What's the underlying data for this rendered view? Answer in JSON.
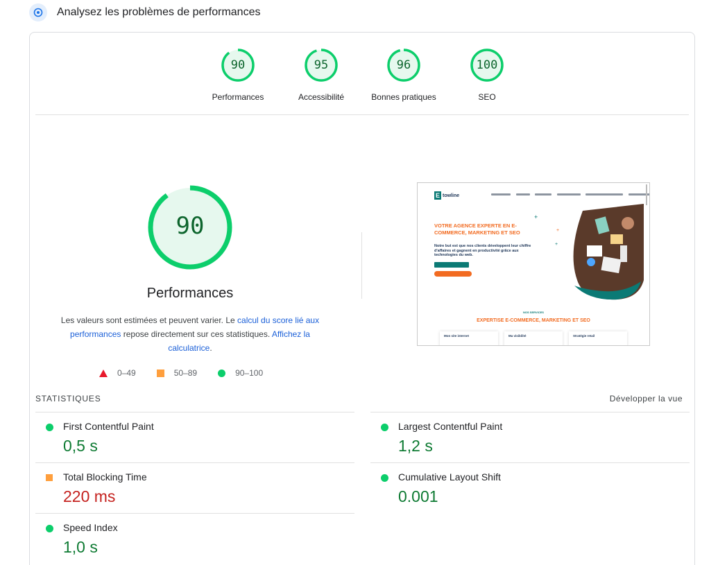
{
  "header": {
    "title": "Analysez les problèmes de performances",
    "icon": "speed-gauge-icon"
  },
  "categories": [
    {
      "label": "Performances",
      "score": "90",
      "value": 90
    },
    {
      "label": "Accessibilité",
      "score": "95",
      "value": 95
    },
    {
      "label": "Bonnes pratiques",
      "score": "96",
      "value": 96
    },
    {
      "label": "SEO",
      "score": "100",
      "value": 100
    }
  ],
  "main": {
    "score": "90",
    "value": 90,
    "label": "Performances",
    "desc_1": "Les valeurs sont estimées et peuvent varier. Le ",
    "desc_link_1": "calcul du score lié aux performances",
    "desc_2": " repose directement sur ces statistiques. ",
    "desc_link_2": "Affichez la calculatrice",
    "desc_3": "."
  },
  "legend": [
    {
      "range": "0–49",
      "shape": "triangle",
      "color": "#e8192c"
    },
    {
      "range": "50–89",
      "shape": "square",
      "color": "#ff9f3d"
    },
    {
      "range": "90–100",
      "shape": "circle",
      "color": "#0cce6b"
    }
  ],
  "screenshot": {
    "logo_letter": "E",
    "logo_text": "towline",
    "headline": "VOTRE AGENCE EXPERTE EN E-COMMERCE, MARKETING ET SEO",
    "paragraph": "Notre but est que nos clients développent leur chiffre d'affaires et gagnent en productivité grâce aux technologies du web.",
    "small_label": "NOS SERVICES",
    "section_title": "EXPERTISE E-COMMERCE, MARKETING ET SEO",
    "cards": [
      "Mon site internet",
      "Ma visibilité",
      "Stratégie retail"
    ]
  },
  "stats": {
    "title": "STATISTIQUES",
    "expand_label": "Développer la vue",
    "metrics": [
      {
        "name": "First Contentful Paint",
        "value": "0,5 s",
        "status": "good"
      },
      {
        "name": "Largest Contentful Paint",
        "value": "1,2 s",
        "status": "good"
      },
      {
        "name": "Total Blocking Time",
        "value": "220 ms",
        "status": "average"
      },
      {
        "name": "Cumulative Layout Shift",
        "value": "0.001",
        "status": "good"
      },
      {
        "name": "Speed Index",
        "value": "1,0 s",
        "status": "good"
      }
    ]
  },
  "colors": {
    "good": "#0cce6b",
    "good_text": "#0d652d",
    "average": "#ff9f3d",
    "fail": "#e8192c",
    "link": "#1a5fd8"
  }
}
